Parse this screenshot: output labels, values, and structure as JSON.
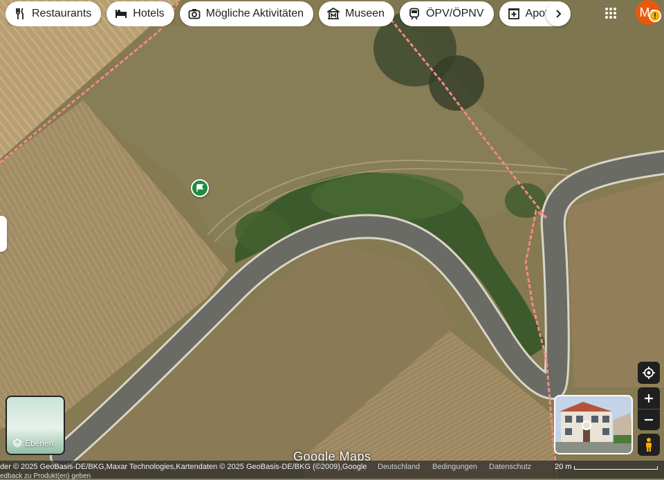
{
  "chips": [
    {
      "label": "Restaurants",
      "icon": "fork-knife-icon"
    },
    {
      "label": "Hotels",
      "icon": "bed-icon"
    },
    {
      "label": "Mögliche Aktivitäten",
      "icon": "camera-icon"
    },
    {
      "label": "Museen",
      "icon": "museum-icon"
    },
    {
      "label": "ÖPV/ÖPNV",
      "icon": "train-icon"
    },
    {
      "label": "Apothe",
      "icon": "pharmacy-icon"
    }
  ],
  "account": {
    "initials": "Ma",
    "warning": "!"
  },
  "layers": {
    "label": "Ebenen"
  },
  "branding": {
    "logo": "Google Maps"
  },
  "footer": {
    "attribution": "der © 2025 GeoBasis-DE/BKG,Maxar Technologies,Kartendaten © 2025 GeoBasis-DE/BKG (©2009),Google",
    "links": [
      "Deutschland",
      "Bedingungen",
      "Datenschutz"
    ],
    "feedback": "edback zu Produkt(en) geben",
    "scale": "20 m"
  },
  "colors": {
    "pin": "#1e8e3e",
    "boundary": "#f28b82",
    "road": "#6b6b66",
    "control_bg": "#1f1f1f"
  }
}
